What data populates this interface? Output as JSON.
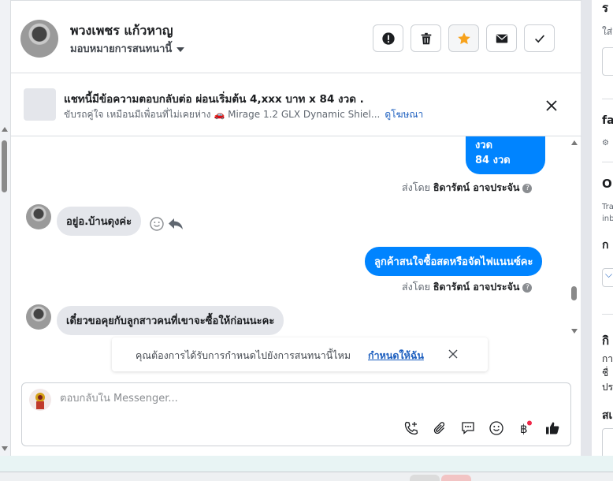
{
  "header": {
    "contact_name": "พวงเพชร แก้วหาญ",
    "assign_label": "มอบหมายการสนทนานี้",
    "buttons": [
      "report-icon",
      "trash-icon",
      "star-icon",
      "envelope-icon",
      "check-icon"
    ],
    "star_color": "#f7a21b"
  },
  "ad": {
    "title": "แชทนี้มีข้อความตอบกลับต่อ ผ่อนเริ่มต้น 4,xxx บาท x 84 งวด .",
    "subtitle": "ขับรถคู่ใจ เหมือนมีเพื่อนที่ไม่เคยห่าง",
    "car_text": "Mirage 1.2 GLX Dynamic Shiel...",
    "link": "ดูโฆษณา"
  },
  "messages": {
    "out_1": {
      "line1": "งวด",
      "line2": "84 งวด"
    },
    "sent_by_1": {
      "prefix": "ส่งโดย",
      "name": "ธิดารัตน์ อาจประจัน"
    },
    "in_1": "อยู่อ.บ้านดุงค่ะ",
    "out_2": "ลูกค้าสนใจซื้อสดหรือจัดไฟแนนซ์คะ",
    "sent_by_2": {
      "prefix": "ส่งโดย",
      "name": "ธิดารัตน์ อาจประจัน"
    },
    "in_2": "เดี๋ยวขอคุยกับลูกสาวคนที่เขาจะซื้อให้ก่อนนะคะ"
  },
  "notice": {
    "text": "คุณต้องการได้รับการกำหนดไปยังการสนทนานี้ไหม",
    "link": "กำหนดให้ฉัน"
  },
  "composer": {
    "placeholder": "ตอบกลับใน Messenger...",
    "tools": [
      "phone-add-icon",
      "paperclip-icon",
      "saved-reply-icon",
      "emoji-icon",
      "baht-icon",
      "thumbs-up-icon"
    ],
    "accent": "#0084ff"
  },
  "right_panel": {
    "t1": "ร",
    "t2": "ใส่",
    "t3": "fa",
    "t4": "O",
    "t5": "Tra",
    "t6": "inb",
    "t7": "ก",
    "t8": "กิ",
    "t9": "กา",
    "t10": "ชื่",
    "t11": "ปร",
    "t12": "สเ"
  }
}
